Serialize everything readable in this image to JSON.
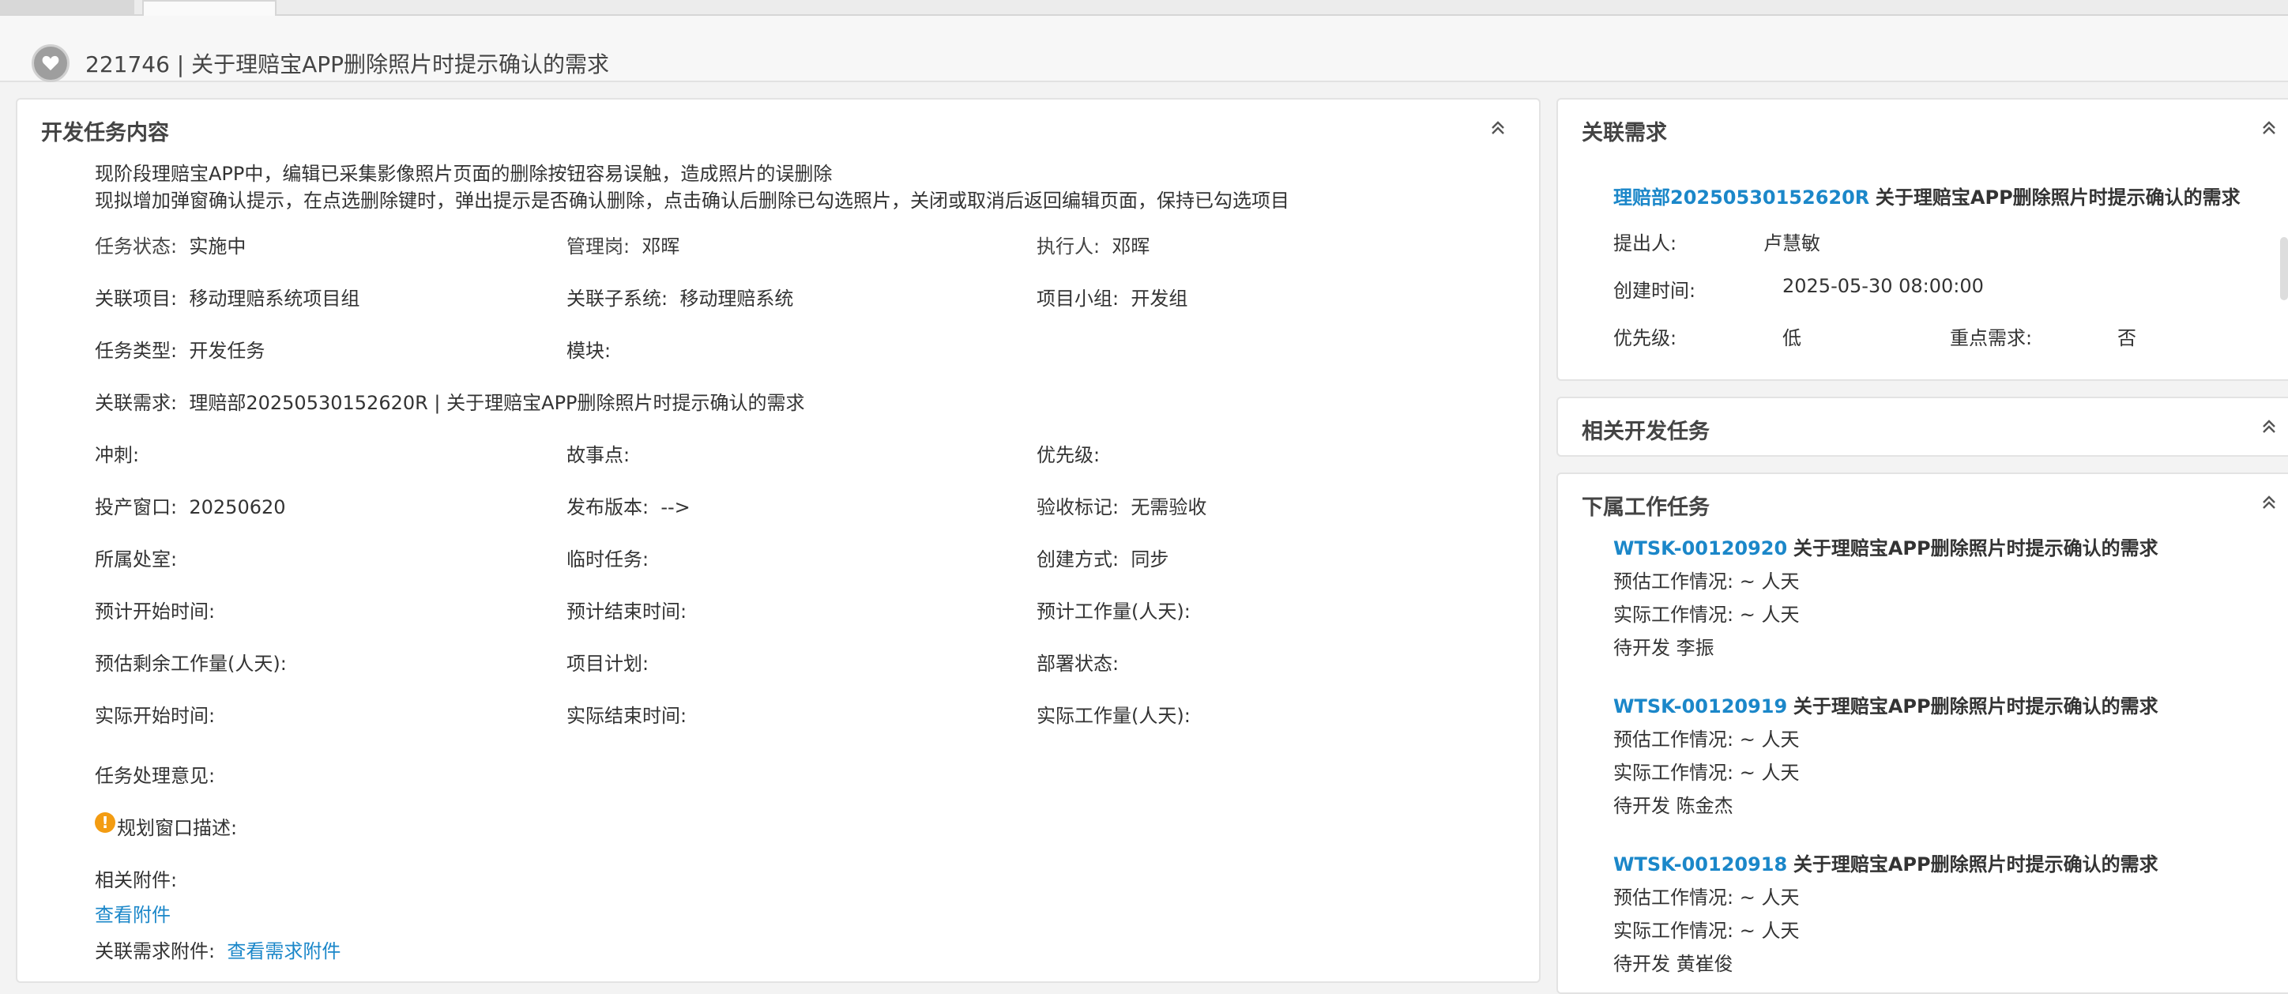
{
  "header": {
    "title": "221746 | 关于理赔宝APP删除照片时提示确认的需求"
  },
  "dev_task": {
    "section_title": "开发任务内容",
    "description_lines": [
      "现阶段理赔宝APP中，编辑已采集影像照片页面的删除按钮容易误触，造成照片的误删除",
      "现拟增加弹窗确认提示，在点选删除键时，弹出提示是否确认删除，点击确认后删除已勾选照片，关闭或取消后返回编辑页面，保持已勾选项目"
    ],
    "fields": {
      "status_label": "任务状态:",
      "status_value": "实施中",
      "manager_label": "管理岗:",
      "manager_value": "邓晖",
      "executor_label": "执行人:",
      "executor_value": "邓晖",
      "project_label": "关联项目:",
      "project_value": "移动理赔系统项目组",
      "subsystem_label": "关联子系统:",
      "subsystem_value": "移动理赔系统",
      "group_label": "项目小组:",
      "group_value": "开发组",
      "type_label": "任务类型:",
      "type_value": "开发任务",
      "module_label": "模块:",
      "module_value": "",
      "req_label": "关联需求:",
      "req_value": "理赔部20250530152620R | 关于理赔宝APP删除照片时提示确认的需求",
      "sprint_label": "冲刺:",
      "sprint_value": "",
      "story_label": "故事点:",
      "story_value": "",
      "priority_label": "优先级:",
      "priority_value": "",
      "window_label": "投产窗口:",
      "window_value": "20250620",
      "release_label": "发布版本:",
      "release_value": "-->",
      "accept_label": "验收标记:",
      "accept_value": "无需验收",
      "dept_label": "所属处室:",
      "dept_value": "",
      "temp_label": "临时任务:",
      "temp_value": "",
      "create_label": "创建方式:",
      "create_value": "同步",
      "plan_start_label": "预计开始时间:",
      "plan_end_label": "预计结束时间:",
      "plan_effort_label": "预计工作量(人天):",
      "remain_label": "预估剩余工作量(人天):",
      "plan_label": "项目计划:",
      "deploy_label": "部署状态:",
      "actual_start_label": "实际开始时间:",
      "actual_end_label": "实际结束时间:",
      "actual_effort_label": "实际工作量(人天):",
      "opinion_label": "任务处理意见:",
      "window_desc_label": "规划窗口描述:",
      "attach_label": "相关附件:",
      "attach_link": "查看附件",
      "req_attach_label": "关联需求附件:",
      "req_attach_link": "查看需求附件"
    }
  },
  "related_req": {
    "section_title": "关联需求",
    "id": "理赔部20250530152620R",
    "name": "关于理赔宝APP删除照片时提示确认的需求",
    "proposer_label": "提出人:",
    "proposer_value": "卢慧敏",
    "created_label": "创建时间:",
    "created_value": "2025-05-30 08:00:00",
    "priority_label": "优先级:",
    "priority_value": "低",
    "key_label": "重点需求:",
    "key_value": "否"
  },
  "related_dev": {
    "section_title": "相关开发任务"
  },
  "sub_tasks": {
    "section_title": "下属工作任务",
    "items": [
      {
        "id": "WTSK-00120920",
        "name": "关于理赔宝APP删除照片时提示确认的需求",
        "est": "预估工作情况: ~ 人天",
        "act": "实际工作情况: ~ 人天",
        "status": "待开发 李振"
      },
      {
        "id": "WTSK-00120919",
        "name": "关于理赔宝APP删除照片时提示确认的需求",
        "est": "预估工作情况: ~ 人天",
        "act": "实际工作情况: ~ 人天",
        "status": "待开发 陈金杰"
      },
      {
        "id": "WTSK-00120918",
        "name": "关于理赔宝APP删除照片时提示确认的需求",
        "est": "预估工作情况: ~ 人天",
        "act": "实际工作情况: ~ 人天",
        "status": "待开发 黄崔俊"
      }
    ]
  },
  "icons": {
    "favorite": "heart-icon",
    "collapse": "double-chevron-up-icon",
    "warning": "exclamation-circle-icon"
  },
  "colors": {
    "link": "#1b87c9",
    "warning": "#f39c12"
  }
}
